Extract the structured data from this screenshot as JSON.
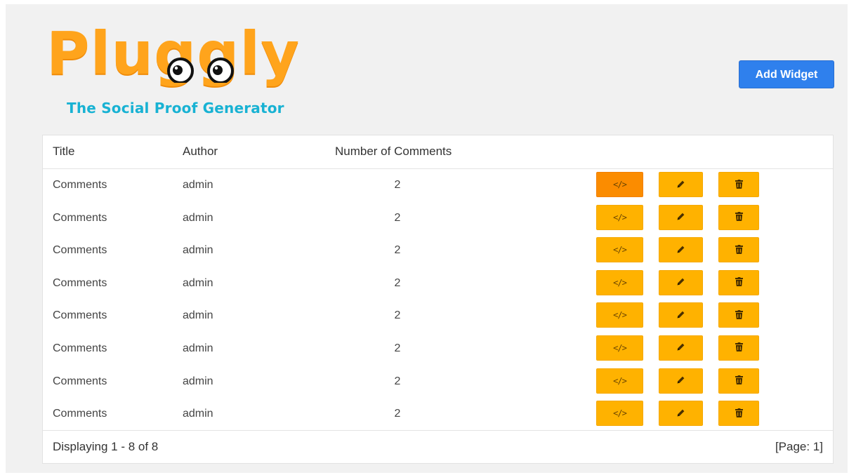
{
  "brand": {
    "name": "Pluggly",
    "tagline": "The Social Proof Generator",
    "colors": {
      "logo": "#ffa41c",
      "tagline": "#18b2d3"
    }
  },
  "header": {
    "add_widget_label": "Add Widget",
    "add_widget_color": "#2f80ed"
  },
  "table": {
    "columns": [
      "Title",
      "Author",
      "Number of Comments"
    ],
    "rows": [
      {
        "title": "Comments",
        "author": "admin",
        "count": "2"
      },
      {
        "title": "Comments",
        "author": "admin",
        "count": "2"
      },
      {
        "title": "Comments",
        "author": "admin",
        "count": "2"
      },
      {
        "title": "Comments",
        "author": "admin",
        "count": "2"
      },
      {
        "title": "Comments",
        "author": "admin",
        "count": "2"
      },
      {
        "title": "Comments",
        "author": "admin",
        "count": "2"
      },
      {
        "title": "Comments",
        "author": "admin",
        "count": "2"
      },
      {
        "title": "Comments",
        "author": "admin",
        "count": "2"
      }
    ],
    "actions": [
      {
        "name": "embed-code",
        "icon": "code-icon",
        "glyph": "</>"
      },
      {
        "name": "edit",
        "icon": "pencil-icon"
      },
      {
        "name": "delete",
        "icon": "trash-icon"
      }
    ],
    "action_color": "#ffb200",
    "active_action_color": "#fb8c00"
  },
  "footer": {
    "displaying": "Displaying 1 - 8 of 8",
    "page": "[Page: 1]"
  }
}
